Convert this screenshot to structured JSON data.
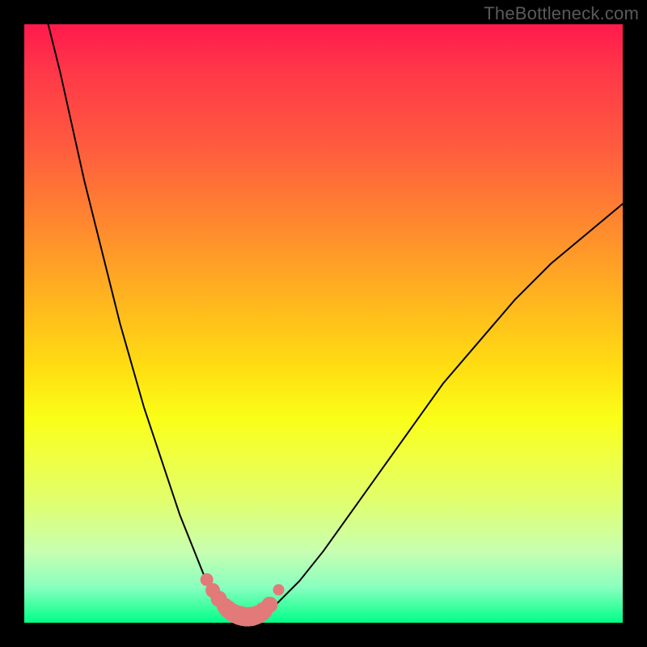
{
  "watermark": "TheBottleneck.com",
  "colors": {
    "frame": "#000000",
    "curve_stroke": "#000000",
    "marker_fill": "#e27a7a",
    "marker_stroke": "#d66a6a"
  },
  "chart_data": {
    "type": "line",
    "title": "",
    "xlabel": "",
    "ylabel": "",
    "xlim": [
      0,
      100
    ],
    "ylim": [
      0,
      100
    ],
    "grid": false,
    "legend": false,
    "series": [
      {
        "name": "bottleneck-curve",
        "x": [
          4,
          6,
          8,
          10,
          12,
          14,
          16,
          18,
          20,
          22,
          24,
          26,
          28,
          30,
          31,
          32,
          33,
          34,
          35,
          36,
          37,
          38,
          39,
          40,
          42,
          46,
          50,
          55,
          60,
          65,
          70,
          76,
          82,
          88,
          94,
          100
        ],
        "y": [
          100,
          92,
          83,
          74,
          66,
          58,
          50,
          43,
          36,
          30,
          24,
          18,
          13,
          8,
          6,
          4.5,
          3.2,
          2.3,
          1.6,
          1.2,
          1.0,
          1.0,
          1.2,
          1.6,
          3,
          7,
          12,
          19,
          26,
          33,
          40,
          47,
          54,
          60,
          65,
          70
        ]
      }
    ],
    "markers": {
      "name": "highlighted-range",
      "x": [
        30.5,
        31.5,
        32.5,
        33.5,
        34.0,
        34.5,
        35.0,
        35.5,
        36.0,
        36.5,
        37.0,
        37.5,
        38.0,
        38.5,
        39.0,
        39.5,
        40.0,
        41.0,
        42.5
      ],
      "y": [
        7.2,
        5.4,
        4.0,
        2.8,
        2.3,
        1.9,
        1.6,
        1.35,
        1.2,
        1.08,
        1.0,
        1.0,
        1.05,
        1.15,
        1.35,
        1.6,
        2.0,
        3.0,
        5.5
      ],
      "size": [
        8,
        9,
        10,
        10,
        11,
        11,
        11.5,
        11.5,
        12,
        12,
        12,
        12,
        12,
        11.5,
        11.5,
        11,
        11,
        10,
        7
      ]
    }
  }
}
